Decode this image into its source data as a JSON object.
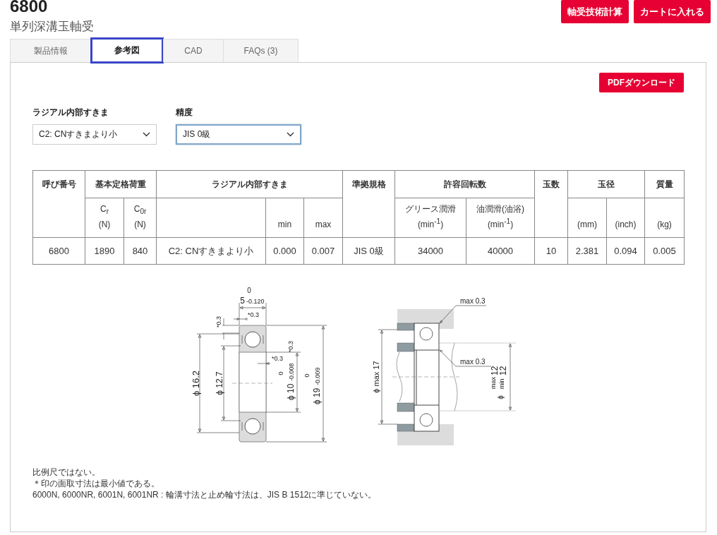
{
  "header": {
    "title": "6800",
    "subtitle": "単列深溝玉軸受",
    "buttons": [
      "軸受技術計算",
      "カートに入れる"
    ]
  },
  "tabs": [
    {
      "label": "製品情報",
      "selected": false
    },
    {
      "label": "参考図",
      "selected": true
    },
    {
      "label": "CAD",
      "selected": false
    },
    {
      "label": "FAQs (3)",
      "selected": false
    }
  ],
  "pdf_button": "PDFダウンロード",
  "filters": [
    {
      "label": "ラジアル内部すきま",
      "value": "C2: CNすきまより小",
      "focused": false
    },
    {
      "label": "精度",
      "value": "JIS 0級",
      "focused": true
    }
  ],
  "table": {
    "header_rows": [
      [
        {
          "text": "呼び番号",
          "rowspan": 2
        },
        {
          "text": "基本定格荷重",
          "colspan": 2
        },
        {
          "text": "ラジアル内部すきま",
          "colspan": 3
        },
        {
          "text": "準拠規格",
          "rowspan": 2
        },
        {
          "text": "許容回転数",
          "colspan": 2
        },
        {
          "text": "玉数",
          "rowspan": 2
        },
        {
          "text": "玉径",
          "colspan": 2
        },
        {
          "text": "質量"
        }
      ],
      [
        {
          "text": "C$_{r}$\n(N)"
        },
        {
          "text": "C$_{0r}$\n(N)"
        },
        null,
        {
          "text": "min"
        },
        {
          "text": "max"
        },
        {
          "text": "グリース潤滑\n(min$^{-1}$)"
        },
        {
          "text": "油潤滑(油浴)\n(min$^{-1}$)"
        },
        {
          "text": "(mm)"
        },
        {
          "text": "(inch)"
        },
        {
          "text": "(kg)"
        }
      ]
    ],
    "rows": [
      [
        "6800",
        "1890",
        "840",
        "C2: CNすきまより小",
        "0.000",
        "0.007",
        "JIS 0級",
        "34000",
        "40000",
        "10",
        "2.381",
        "0.094",
        "0.005"
      ]
    ]
  },
  "dimension_drawing": {
    "labels": [
      "0",
      "5",
      "-0.120",
      "*0.3",
      "*0.3",
      "ϕ 16.2",
      "ϕ 12.7",
      "*0.3",
      "*0.3",
      "0",
      "ϕ 10",
      "-0.008",
      "0",
      "ϕ 19",
      "-0.009"
    ]
  },
  "mounting_drawing": {
    "labels": [
      "max 0.3",
      "max 0.3",
      "ϕ max 17",
      "ϕ",
      "max",
      "12",
      "min",
      "12"
    ]
  },
  "notes": [
    "比例尺ではない。",
    "＊印の面取寸法は最小値である。",
    "6000N, 6000NR, 6001N, 6001NR : 輪溝寸法と止め輪寸法は、JIS B 1512に準じていない。"
  ]
}
